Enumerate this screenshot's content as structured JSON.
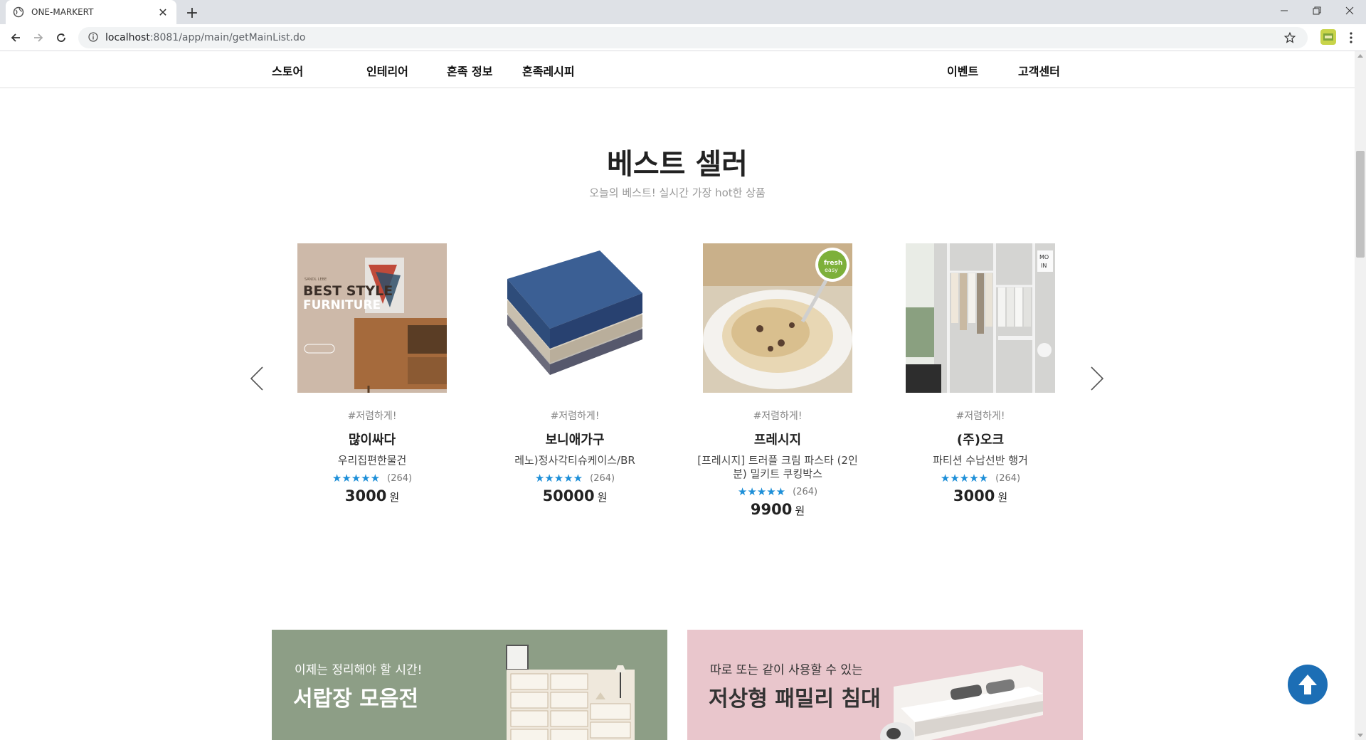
{
  "browser": {
    "tab_title": "ONE-MARKERT",
    "url_host": "localhost",
    "url_path": ":8081/app/main/getMainList.do"
  },
  "nav": {
    "left": [
      "스토어",
      "인테리어",
      "혼족 정보",
      "혼족레시피"
    ],
    "right": [
      "이벤트",
      "고객센터"
    ]
  },
  "bestseller": {
    "title": "베스트 셀러",
    "subtitle": "오늘의 베스트! 실시간 가장 hot한 상품",
    "products": [
      {
        "tag": "#저렴하게!",
        "brand": "많이싸다",
        "name": "우리집편한물건",
        "stars": "★★★★★",
        "reviews": "(264)",
        "price": "3000",
        "unit": "원",
        "image_text": [
          "SANDL LEBE",
          "BEST STYLE",
          "FURNITURE"
        ]
      },
      {
        "tag": "#저렴하게!",
        "brand": "보니애가구",
        "name": "레노)정사각티슈케이스/BR",
        "stars": "★★★★★",
        "reviews": "(264)",
        "price": "50000",
        "unit": "원"
      },
      {
        "tag": "#저렴하게!",
        "brand": "프레시지",
        "name": "[프레시지] 트러플 크림 파스타 (2인분) 밀키트 쿠킹박스",
        "stars": "★★★★★",
        "reviews": "(264)",
        "price": "9900",
        "unit": "원",
        "image_text": [
          "fresh",
          "easy"
        ]
      },
      {
        "tag": "#저렴하게!",
        "brand": "(주)오크",
        "name": "파티션 수납선반 행거",
        "stars": "★★★★★",
        "reviews": "(264)",
        "price": "3000",
        "unit": "원",
        "image_text": [
          "MO",
          "IN"
        ]
      }
    ]
  },
  "banners": [
    {
      "sub": "이제는 정리해야 할 시간!",
      "main": "서랍장 모음전",
      "bg": "#8d9e86"
    },
    {
      "sub": "따로 또는 같이 사용할 수 있는",
      "main": "저상형 패밀리 침대",
      "bg": "#e9c6cc"
    }
  ],
  "colors": {
    "accent": "#1c6eb5",
    "star": "#1d8fd8"
  }
}
